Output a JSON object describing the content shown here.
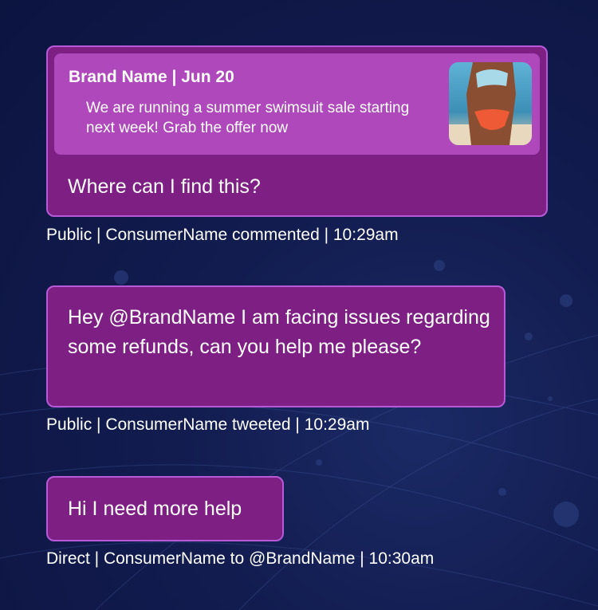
{
  "messages": [
    {
      "quoted_post": {
        "header": "Brand Name | Jun 20",
        "body": "We are running a summer swimsuit sale starting next week! Grab the offer now",
        "thumbnail_icon": "swimsuit-photo"
      },
      "text": "Where can I find this?",
      "meta": "Public | ConsumerName commented | 10:29am"
    },
    {
      "text": "Hey @BrandName I am facing issues regarding some refunds, can you help me please?",
      "meta": "Public | ConsumerName tweeted | 10:29am"
    },
    {
      "text": "Hi I need more help",
      "meta": "Direct | ConsumerName to @BrandName | 10:30am"
    }
  ],
  "colors": {
    "background": "#121c4f",
    "card": "#7e1f84",
    "card_border": "#b65ad8",
    "quote": "#ae48bb"
  }
}
